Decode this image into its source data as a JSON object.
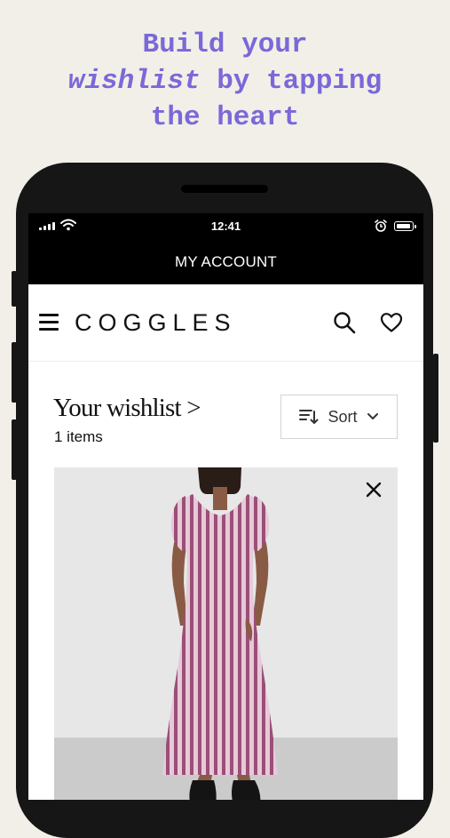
{
  "promo": {
    "line1": "Build your",
    "line2_em": "wishlist",
    "line2_rest": " by tapping",
    "line3": "the heart",
    "color": "#7b68d8"
  },
  "status_bar": {
    "time": "12:41",
    "icons": [
      "signal-icon",
      "wifi-icon",
      "alarm-icon",
      "battery-icon"
    ]
  },
  "top_bar": {
    "title": "MY ACCOUNT"
  },
  "header": {
    "logo": "COGGLES",
    "icons": [
      "menu-icon",
      "search-icon",
      "heart-icon"
    ]
  },
  "wishlist": {
    "title": "Your wishlist >",
    "count": "1 items",
    "sort_label": "Sort",
    "sort_icons": [
      "sort-icon",
      "chevron-down-icon"
    ]
  },
  "product": {
    "image_icon": "striped-dress-image",
    "remove_icon": "close-icon",
    "stripe_color": "#9b4f78"
  }
}
